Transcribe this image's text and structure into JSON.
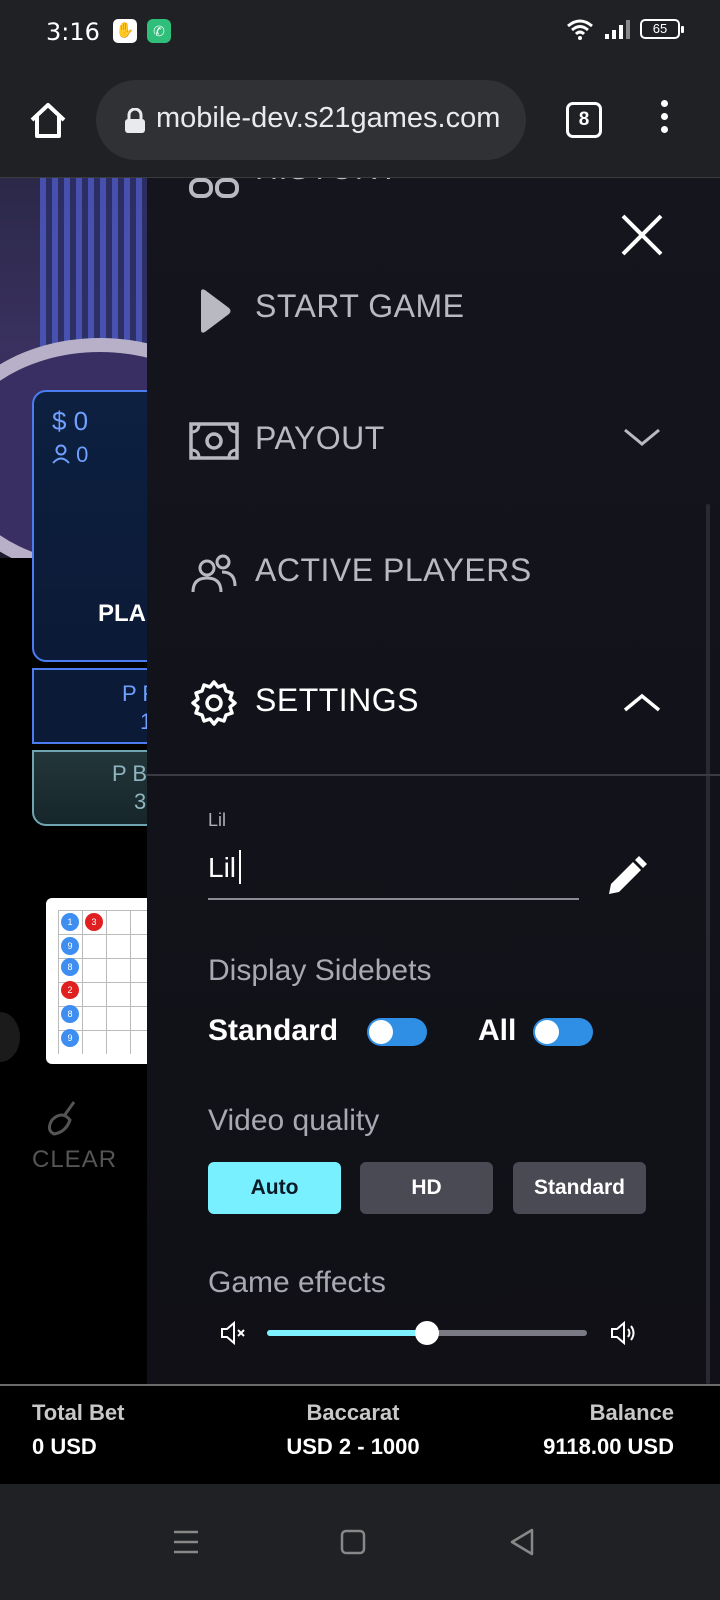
{
  "status_bar": {
    "time": "3:16",
    "battery": "65"
  },
  "browser": {
    "url": "mobile-dev.s21games.com",
    "tab_count": "8"
  },
  "game": {
    "player_bet": "$ 0",
    "player_count": "0",
    "player_label": "PLA",
    "pp_label": "P P",
    "pp_value": "1",
    "pbo_label": "P BC",
    "pbo_value": "3",
    "clear_label": "CLEAR",
    "roadmap_dots": [
      {
        "text": "1",
        "color": "#3d8ef0"
      },
      {
        "text": "3",
        "color": "#e02020"
      },
      {
        "text": "9",
        "color": "#3d8ef0"
      },
      {
        "text": "8",
        "color": "#3d8ef0"
      },
      {
        "text": "2",
        "color": "#e02020"
      },
      {
        "text": "8",
        "color": "#3d8ef0"
      },
      {
        "text": "9",
        "color": "#3d8ef0"
      }
    ]
  },
  "drawer": {
    "menu": {
      "history": "HISTORY",
      "start_game": "START GAME",
      "payout": "PAYOUT",
      "active_players": "ACTIVE PLAYERS",
      "settings": "SETTINGS"
    },
    "settings": {
      "name_label": "Lil",
      "name_value": "Lil",
      "display_sidebets_title": "Display Sidebets",
      "toggle_standard_label": "Standard",
      "toggle_all_label": "All",
      "video_quality_title": "Video quality",
      "video_quality_options": [
        "Auto",
        "HD",
        "Standard"
      ],
      "video_quality_selected": "Auto",
      "game_effects_title": "Game effects",
      "game_effects_volume": 0.5
    },
    "accent_color": "#79f0ff"
  },
  "bottom_bar": {
    "total_bet_title": "Total Bet",
    "total_bet_value": "0 USD",
    "game_title": "Baccarat",
    "game_limits": "USD 2 - 1000",
    "balance_title": "Balance",
    "balance_value": "9118.00 USD"
  }
}
